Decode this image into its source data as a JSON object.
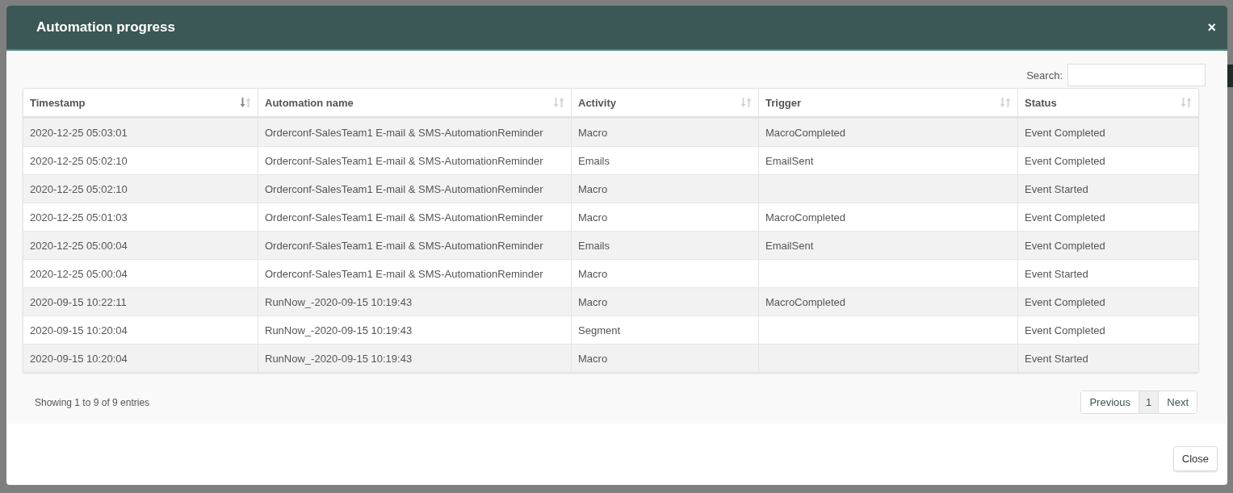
{
  "modal": {
    "title": "Automation progress",
    "close_icon": "×"
  },
  "search": {
    "label": "Search:"
  },
  "table": {
    "columns": [
      {
        "label": "Timestamp",
        "sorted": true
      },
      {
        "label": "Automation name",
        "sorted": false
      },
      {
        "label": "Activity",
        "sorted": false
      },
      {
        "label": "Trigger",
        "sorted": false
      },
      {
        "label": "Status",
        "sorted": false
      }
    ],
    "rows": [
      [
        "2020-12-25 05:03:01",
        "Orderconf-SalesTeam1 E-mail & SMS-AutomationReminder",
        "Macro",
        "MacroCompleted",
        "Event Completed"
      ],
      [
        "2020-12-25 05:02:10",
        "Orderconf-SalesTeam1 E-mail & SMS-AutomationReminder",
        "Emails",
        "EmailSent",
        "Event Completed"
      ],
      [
        "2020-12-25 05:02:10",
        "Orderconf-SalesTeam1 E-mail & SMS-AutomationReminder",
        "Macro",
        "",
        "Event Started"
      ],
      [
        "2020-12-25 05:01:03",
        "Orderconf-SalesTeam1 E-mail & SMS-AutomationReminder",
        "Macro",
        "MacroCompleted",
        "Event Completed"
      ],
      [
        "2020-12-25 05:00:04",
        "Orderconf-SalesTeam1 E-mail & SMS-AutomationReminder",
        "Emails",
        "EmailSent",
        "Event Completed"
      ],
      [
        "2020-12-25 05:00:04",
        "Orderconf-SalesTeam1 E-mail & SMS-AutomationReminder",
        "Macro",
        "",
        "Event Started"
      ],
      [
        "2020-09-15 10:22:11",
        "RunNow_-2020-09-15 10:19:43",
        "Macro",
        "MacroCompleted",
        "Event Completed"
      ],
      [
        "2020-09-15 10:20:04",
        "RunNow_-2020-09-15 10:19:43",
        "Segment",
        "",
        "Event Completed"
      ],
      [
        "2020-09-15 10:20:04",
        "RunNow_-2020-09-15 10:19:43",
        "Macro",
        "",
        "Event Started"
      ]
    ]
  },
  "info": "Showing 1 to 9 of 9 entries",
  "pagination": {
    "previous": "Previous",
    "pages": [
      {
        "label": "1",
        "selected": true
      }
    ],
    "next": "Next"
  },
  "footer": {
    "close_button": "Close"
  }
}
